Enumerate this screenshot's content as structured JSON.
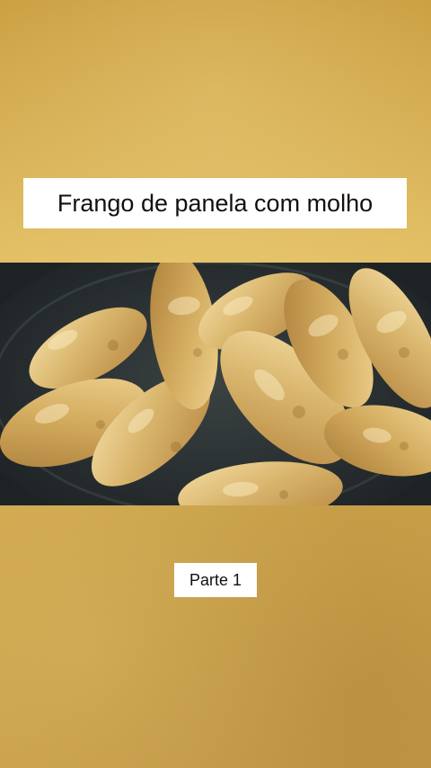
{
  "title": "Frango de panela com molho",
  "part_label": "Parte 1",
  "image": {
    "subject": "chicken-drumsticks-frying-pan"
  },
  "colors": {
    "background_gold": "#d8b155",
    "label_background": "#ffffff",
    "label_text": "#111111",
    "pan_dark": "#1f2527",
    "chicken_base": "#d9b56b",
    "chicken_highlight": "#f3d89a"
  }
}
